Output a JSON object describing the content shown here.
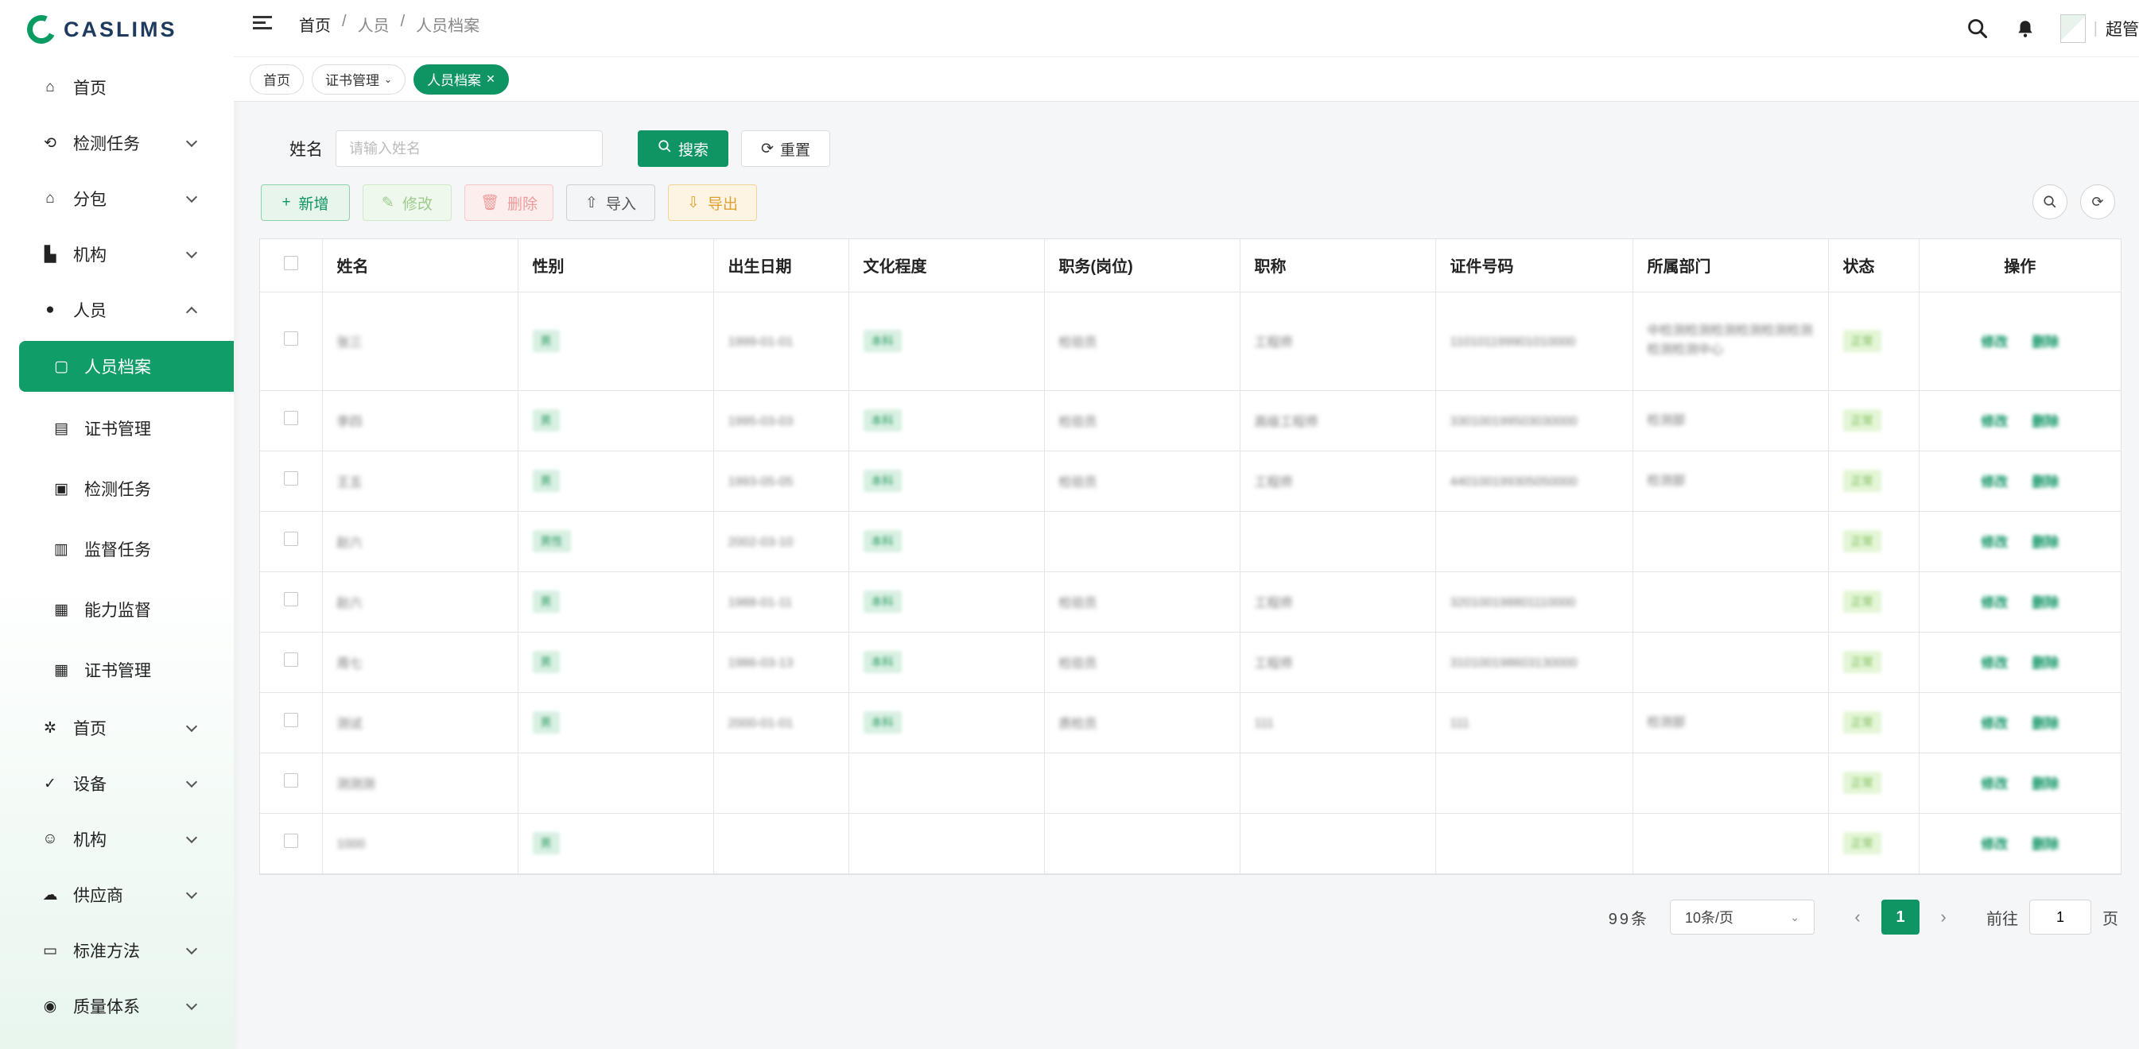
{
  "app": {
    "logo_text": "CASLIMS"
  },
  "header": {
    "breadcrumb": [
      "首页",
      "人员",
      "人员档案"
    ],
    "user_name": "超管"
  },
  "sidebar": {
    "items": [
      {
        "label": "首页",
        "icon": "dashboard-icon",
        "expand": "none"
      },
      {
        "label": "检测任务",
        "icon": "task-icon",
        "expand": "down"
      },
      {
        "label": "分包",
        "icon": "subcontract-icon",
        "expand": "down"
      },
      {
        "label": "机构",
        "icon": "org-icon",
        "expand": "down"
      },
      {
        "label": "人员",
        "icon": "person-icon",
        "expand": "up"
      },
      {
        "label": "人员档案",
        "icon": "person-file-icon",
        "sub": true,
        "active": true
      },
      {
        "label": "证书管理",
        "icon": "certificate-icon",
        "sub": true
      },
      {
        "label": "检测任务",
        "icon": "inspection-icon",
        "sub": true
      },
      {
        "label": "监督任务",
        "icon": "supervision-icon",
        "sub": true
      },
      {
        "label": "能力监督",
        "icon": "ability-icon",
        "sub": true
      },
      {
        "label": "证书管理",
        "icon": "calendar-icon",
        "sub": true
      },
      {
        "label": "首页",
        "icon": "gear-icon",
        "expand": "down"
      },
      {
        "label": "设备",
        "icon": "check-icon",
        "expand": "down"
      },
      {
        "label": "机构",
        "icon": "smile-icon",
        "expand": "down"
      },
      {
        "label": "供应商",
        "icon": "cloud-icon",
        "expand": "down"
      },
      {
        "label": "标准方法",
        "icon": "document-icon",
        "expand": "down"
      },
      {
        "label": "质量体系",
        "icon": "globe-icon",
        "expand": "down"
      }
    ]
  },
  "tags": [
    {
      "label": "首页",
      "active": false
    },
    {
      "label": "证书管理",
      "active": false
    },
    {
      "label": "人员档案",
      "active": true
    }
  ],
  "search": {
    "label": "姓名",
    "placeholder": "请输入姓名",
    "search_label": "搜索",
    "reset_label": "重置"
  },
  "toolbar": {
    "add": "新增",
    "edit": "修改",
    "delete": "删除",
    "import": "导入",
    "export": "导出"
  },
  "table": {
    "columns": [
      "姓名",
      "性别",
      "出生日期",
      "文化程度",
      "职务(岗位)",
      "职称",
      "证件号码",
      "所属部门",
      "状态",
      "操作"
    ],
    "rows": [
      {
        "name": "张三",
        "gender": "男",
        "birth": "1999-01-01",
        "edu": "本科",
        "post": "检验员",
        "title": "工程师",
        "id": "110101199901010000",
        "dept": "中检测检测检测检测检测检测检测检测中心",
        "status": "正常"
      },
      {
        "name": "李四",
        "gender": "男",
        "birth": "1995-03-03",
        "edu": "本科",
        "post": "检验员",
        "title": "高级工程师",
        "id": "330100199503030000",
        "dept": "检测部",
        "status": "正常"
      },
      {
        "name": "王五",
        "gender": "男",
        "birth": "1993-05-05",
        "edu": "本科",
        "post": "检验员",
        "title": "工程师",
        "id": "440100199305050000",
        "dept": "检测部",
        "status": "正常"
      },
      {
        "name": "赵六",
        "gender": "男性",
        "birth": "2002-03-10",
        "edu": "本科",
        "post": "",
        "title": "",
        "id": "",
        "dept": "",
        "status": "正常"
      },
      {
        "name": "赵六",
        "gender": "男",
        "birth": "1988-01-11",
        "edu": "本科",
        "post": "检验员",
        "title": "工程师",
        "id": "320100198801110000",
        "dept": "",
        "status": "正常"
      },
      {
        "name": "周七",
        "gender": "男",
        "birth": "1986-03-13",
        "edu": "本科",
        "post": "检验员",
        "title": "工程师",
        "id": "310100198603130000",
        "dept": "",
        "status": "正常"
      },
      {
        "name": "测试",
        "gender": "男",
        "birth": "2000-01-01",
        "edu": "本科",
        "post": "质检员",
        "title": "111",
        "id": "111",
        "dept": "检测部",
        "status": "正常"
      },
      {
        "name": "测测测",
        "gender": "",
        "birth": "",
        "edu": "",
        "post": "",
        "title": "",
        "id": "",
        "dept": "",
        "status": "正常"
      },
      {
        "name": "1000",
        "gender": "男",
        "birth": "",
        "edu": "",
        "post": "",
        "title": "",
        "id": "",
        "dept": "",
        "status": "正常"
      }
    ],
    "ops": {
      "edit": "修改",
      "delete": "删除"
    }
  },
  "pagination": {
    "total": "99条",
    "page_size": "10条/页",
    "current_page": "1",
    "goto_label": "前往",
    "goto_value": "1",
    "page_suffix": "页"
  },
  "colors": {
    "primary": "#0f9463",
    "sidebar_active": "#119d68"
  }
}
